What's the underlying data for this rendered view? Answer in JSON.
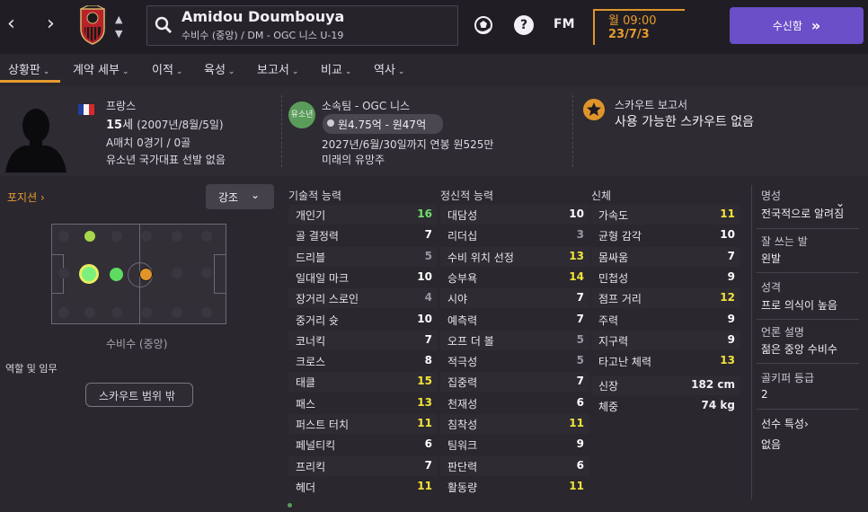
{
  "header": {
    "player_name": "Amidou Doumbouya",
    "player_sub": "수비수 (중앙) / DM - OGC 니스 U-19",
    "date_day_time": "월 09:00",
    "date": "23/7/3",
    "continue_label": "수신함",
    "fm_label": "FM",
    "help_label": "?"
  },
  "tabs": [
    {
      "label": "상황판"
    },
    {
      "label": "계약 세부"
    },
    {
      "label": "이적"
    },
    {
      "label": "육성"
    },
    {
      "label": "보고서"
    },
    {
      "label": "비교"
    },
    {
      "label": "역사"
    }
  ],
  "info": {
    "nation": "프랑스",
    "age_value": "15",
    "age_suffix": "세",
    "birth": "(2007년/8월/5일)",
    "caps": "A매치 0경기 / 0골",
    "youth_caps": "유소년 국가대표 선발 없음",
    "club_badge": "유소년",
    "club": "소속팀 - OGC 니스",
    "value_text": "원4.75억 - 원47억",
    "contract": "2027년/6월/30일까지 연봉 원525만",
    "potential": "미래의 유망주",
    "scout_title": "스카우트 보고서",
    "scout_none": "사용 가능한 스카우트 없음"
  },
  "position": {
    "label": "포지션",
    "highlight_label": "강조",
    "caption": "수비수 (중앙)",
    "roles_label": "역할 및 임무",
    "scout_range_label": "스카우트 범위 밖"
  },
  "technical": {
    "title": "기술적 능력",
    "attrs": [
      {
        "name": "개인기",
        "value": "16",
        "color": "#6fe06a"
      },
      {
        "name": "골 결정력",
        "value": "7",
        "color": "#ffffff"
      },
      {
        "name": "드리블",
        "value": "5",
        "color": "#9b97a2"
      },
      {
        "name": "일대일 마크",
        "value": "10",
        "color": "#ffffff"
      },
      {
        "name": "장거리 스로인",
        "value": "4",
        "color": "#9b97a2"
      },
      {
        "name": "중거리 슛",
        "value": "10",
        "color": "#ffffff"
      },
      {
        "name": "코너킥",
        "value": "7",
        "color": "#ffffff"
      },
      {
        "name": "크로스",
        "value": "8",
        "color": "#ffffff"
      },
      {
        "name": "태클",
        "value": "15",
        "color": "#f2e33a"
      },
      {
        "name": "패스",
        "value": "13",
        "color": "#f2e33a"
      },
      {
        "name": "퍼스트 터치",
        "value": "11",
        "color": "#f2e33a"
      },
      {
        "name": "페널티킥",
        "value": "6",
        "color": "#ffffff"
      },
      {
        "name": "프리킥",
        "value": "7",
        "color": "#ffffff"
      },
      {
        "name": "헤더",
        "value": "11",
        "color": "#f2e33a"
      }
    ]
  },
  "mental": {
    "title": "정신적 능력",
    "attrs": [
      {
        "name": "대담성",
        "value": "10",
        "color": "#ffffff"
      },
      {
        "name": "리더십",
        "value": "3",
        "color": "#9b97a2"
      },
      {
        "name": "수비 위치 선정",
        "value": "13",
        "color": "#f2e33a"
      },
      {
        "name": "승부욕",
        "value": "14",
        "color": "#f2e33a"
      },
      {
        "name": "시야",
        "value": "7",
        "color": "#ffffff"
      },
      {
        "name": "예측력",
        "value": "7",
        "color": "#ffffff"
      },
      {
        "name": "오프 더 볼",
        "value": "5",
        "color": "#9b97a2"
      },
      {
        "name": "적극성",
        "value": "5",
        "color": "#9b97a2"
      },
      {
        "name": "집중력",
        "value": "7",
        "color": "#ffffff"
      },
      {
        "name": "천재성",
        "value": "6",
        "color": "#ffffff"
      },
      {
        "name": "침착성",
        "value": "11",
        "color": "#f2e33a"
      },
      {
        "name": "팀워크",
        "value": "9",
        "color": "#ffffff"
      },
      {
        "name": "판단력",
        "value": "6",
        "color": "#ffffff"
      },
      {
        "name": "활동량",
        "value": "11",
        "color": "#f2e33a"
      }
    ]
  },
  "physical": {
    "title": "신체",
    "attrs": [
      {
        "name": "가속도",
        "value": "11",
        "color": "#f2e33a"
      },
      {
        "name": "균형 감각",
        "value": "10",
        "color": "#ffffff"
      },
      {
        "name": "몸싸움",
        "value": "7",
        "color": "#ffffff"
      },
      {
        "name": "민첩성",
        "value": "9",
        "color": "#ffffff"
      },
      {
        "name": "점프 거리",
        "value": "12",
        "color": "#f2e33a"
      },
      {
        "name": "주력",
        "value": "9",
        "color": "#ffffff"
      },
      {
        "name": "지구력",
        "value": "9",
        "color": "#ffffff"
      },
      {
        "name": "타고난 체력",
        "value": "13",
        "color": "#f2e33a"
      }
    ],
    "height_label": "신장",
    "height_value": "182 cm",
    "weight_label": "체중",
    "weight_value": "74 kg"
  },
  "side": {
    "reputation_label": "명성",
    "reputation_value": "전국적으로 알려짐",
    "foot_label": "잘 쓰는 발",
    "foot_value": "왼발",
    "personality_label": "성격",
    "personality_value": "프로 의식이 높음",
    "media_label": "언론 설명",
    "media_value": "젊은 중앙 수비수",
    "gk_label": "골키퍼 등급",
    "gk_value": "2",
    "traits_label": "선수 특성",
    "traits_value": "없음"
  }
}
